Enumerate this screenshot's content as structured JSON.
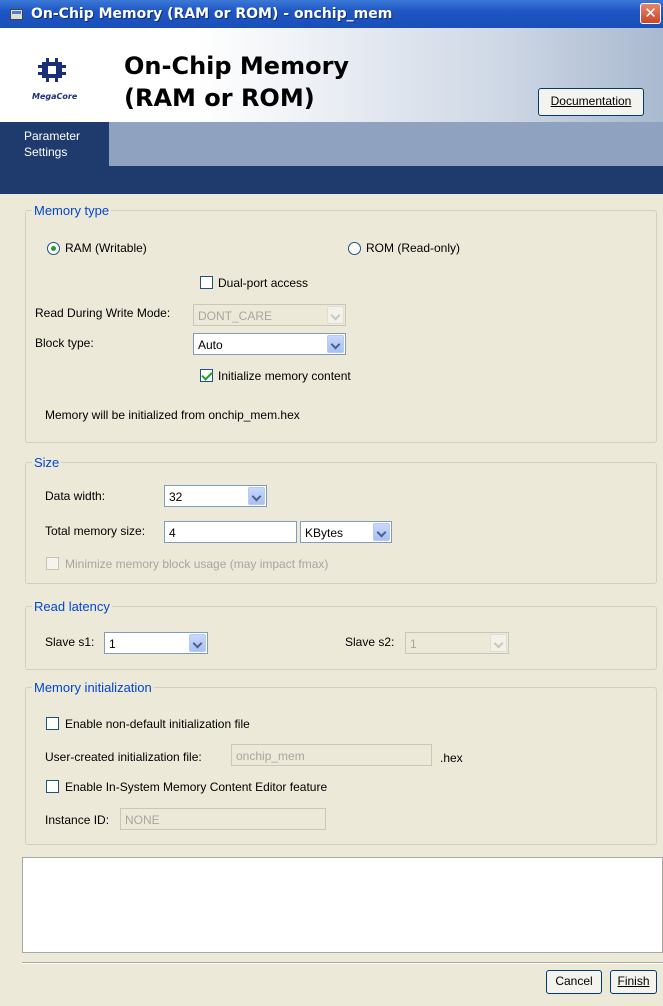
{
  "window": {
    "title": "On-Chip Memory (RAM or ROM) - onchip_mem",
    "close_glyph": "✕"
  },
  "header": {
    "title_line1": "On-Chip Memory",
    "title_line2": "(RAM or ROM)",
    "logo_text": "MegaCore",
    "documentation_label": "Documentation"
  },
  "tabs": {
    "parameter_settings_line1": "Parameter",
    "parameter_settings_line2": "Settings"
  },
  "memory_type": {
    "legend": "Memory type",
    "ram_label": "RAM (Writable)",
    "rom_label": "ROM (Read-only)",
    "ram_selected": true,
    "dual_port_label": "Dual-port access",
    "dual_port_checked": false,
    "read_during_write_label": "Read During Write Mode:",
    "read_during_write_value": "DONT_CARE",
    "block_type_label": "Block type:",
    "block_type_value": "Auto",
    "init_content_label": "Initialize memory content",
    "init_content_checked": true,
    "init_message": "Memory will be initialized from onchip_mem.hex"
  },
  "size": {
    "legend": "Size",
    "data_width_label": "Data width:",
    "data_width_value": "32",
    "total_size_label": "Total memory size:",
    "total_size_value": "4",
    "unit_value": "KBytes",
    "minimize_label": "Minimize memory block usage (may impact fmax)"
  },
  "read_latency": {
    "legend": "Read latency",
    "slave_s1_label": "Slave s1:",
    "slave_s1_value": "1",
    "slave_s2_label": "Slave s2:",
    "slave_s2_value": "1"
  },
  "memory_init": {
    "legend": "Memory initialization",
    "enable_file_label": "Enable non-default initialization file",
    "user_file_label": "User-created initialization file:",
    "user_file_value": "onchip_mem",
    "hex_suffix": ".hex",
    "enable_editor_label": "Enable In-System Memory Content Editor feature",
    "instance_id_label": "Instance ID:",
    "instance_id_value": "NONE"
  },
  "footer": {
    "cancel_label": "Cancel",
    "finish_label": "Finish"
  },
  "colors": {
    "titlebar": "#1e56c4",
    "nav_dark": "#1f3b6e",
    "legend_blue": "#0046d5",
    "check_green": "#21a121"
  }
}
